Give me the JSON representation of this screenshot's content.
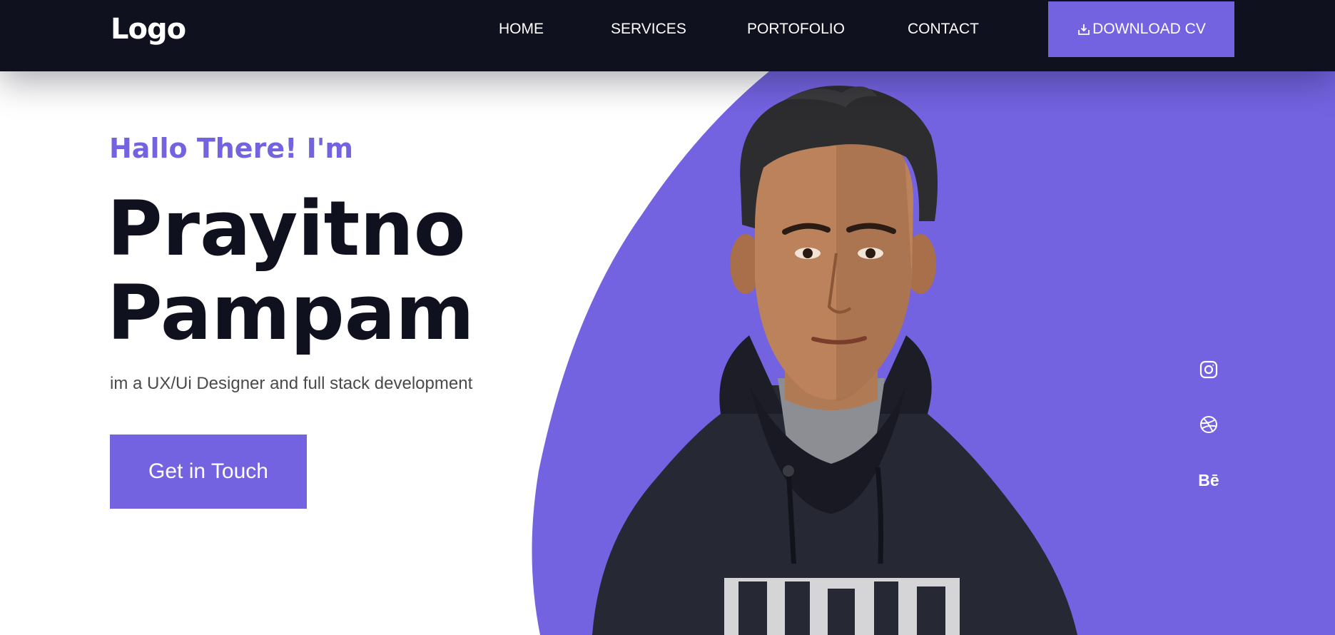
{
  "header": {
    "logo": "Logo",
    "nav": {
      "home": "HOME",
      "services": "SERVICES",
      "portfolio": "PORTOFOLIO",
      "contact": "CONTACT"
    },
    "cv_button": "DOWNLOAD CV",
    "cv_icon": "download-icon"
  },
  "hero": {
    "greeting": "Hallo There! I'm",
    "name_first": "Prayitno",
    "name_last": "Pampam",
    "tagline": "im a UX/Ui Designer and full stack development",
    "cta": "Get in Touch",
    "portrait": "portrait-photo"
  },
  "social": {
    "instagram": "instagram-icon",
    "dribbble": "dribbble-icon",
    "behance": "Bē"
  },
  "colors": {
    "accent": "#7363e1",
    "dark": "#10111f",
    "text_muted": "#4a4a4a",
    "white": "#ffffff"
  }
}
